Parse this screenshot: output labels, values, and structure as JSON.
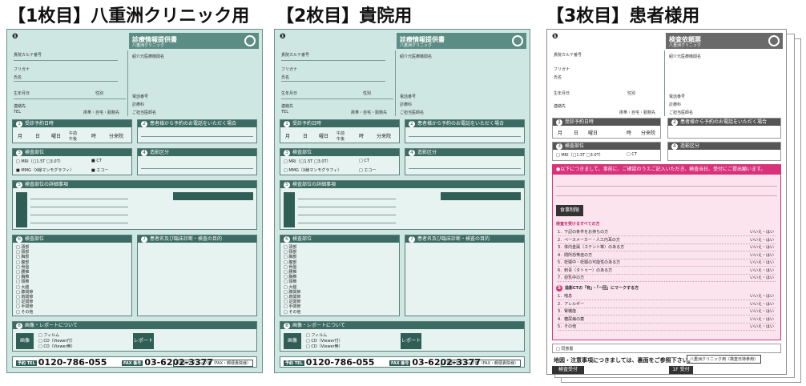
{
  "titles": [
    "【1枚目】八重洲クリニック用",
    "【2枚目】貴院用",
    "【3枚目】患者様用"
  ],
  "sheet1": {
    "header_title": "診療情報提供書",
    "header_sub": "八重洲クリニック",
    "field_karte": "貴院カルテ番号",
    "field_kana": "フリガナ",
    "field_name": "氏名",
    "field_birth": "生年月日",
    "field_sex": "性別",
    "field_contact": "連絡先",
    "field_tel": "TEL",
    "field_phone_kinds": "携帯・自宅・勤務先",
    "field_referrer": "紹介元医療機関名",
    "field_phone_no": "電話番号",
    "field_doctor": "診療科",
    "field_doctor_name": "ご担当医師名",
    "sec1": "受診予約日時",
    "sec1_cols": [
      "月",
      "日",
      "曜日",
      "午前 午後",
      "時",
      "分来院"
    ],
    "sec2": "患者様から予約のお電話をいただく場合",
    "sec3": "検査部位",
    "sec3_opts": [
      "MRI（□1.5T □3.0T）",
      "CT",
      "MMG（X線マンモグラフィ）",
      "エコー"
    ],
    "sec4": "造影区分",
    "sec5": "検査部位の詳細事項",
    "sec6": "検査部位",
    "sec6_rows": [
      "頭部",
      "頸部",
      "胸部",
      "腹部",
      "骨盤",
      "腰椎",
      "胸椎",
      "頸椎",
      "大腿",
      "膝関節",
      "肩関節",
      "足関節",
      "手関節",
      "その他"
    ],
    "sec7": "患者名及び臨床診断・検査の目的",
    "sec8": "画像・レポートについて",
    "sec8_opts": [
      "フィルム",
      "CD（Viewer付）",
      "CD（Viewer無）"
    ],
    "report": "レポート",
    "tel_label": "予約 TEL",
    "tel": "0120-786-055",
    "fax_label": "FAX 番号",
    "fax": "03-6202-3377",
    "fax_note": "八重洲クリニック用（FAX・郵便貴院様）"
  },
  "sheet3": {
    "header_title": "検査依頼票",
    "notice": "●以下につきまして、事前に、ご確認のうえご記入いただき、検査当日、受付にご提出願います。",
    "meal": "食事制限",
    "check_title": "検査を受けるすべての方",
    "items": [
      "1．下記の条件をお持ちの方",
      "2．ペースメーカー・人工内耳の方",
      "3．体内金属（ステント等）のある方",
      "4．閉所恐怖症の方",
      "5．妊娠中・妊娠の可能性のある方",
      "6．刺青（タトゥー）のある方",
      "7．授乳中の方"
    ],
    "yesno": "いいえ・はい",
    "sec_ct": "造影CTの「有」・「一回」にマークする方",
    "ct_items": [
      "1．喘息",
      "2．アレルギー",
      "3．腎機能",
      "4．糖尿病の薬",
      "5．その他"
    ],
    "consent": "同意書",
    "bottom": "地図・注意事項につきましては、裏面をご参照下さい。",
    "bottom_btn": "八重洲クリニック用（検査日持参用）",
    "reception": "検査受付",
    "floor": "1F 受付"
  }
}
